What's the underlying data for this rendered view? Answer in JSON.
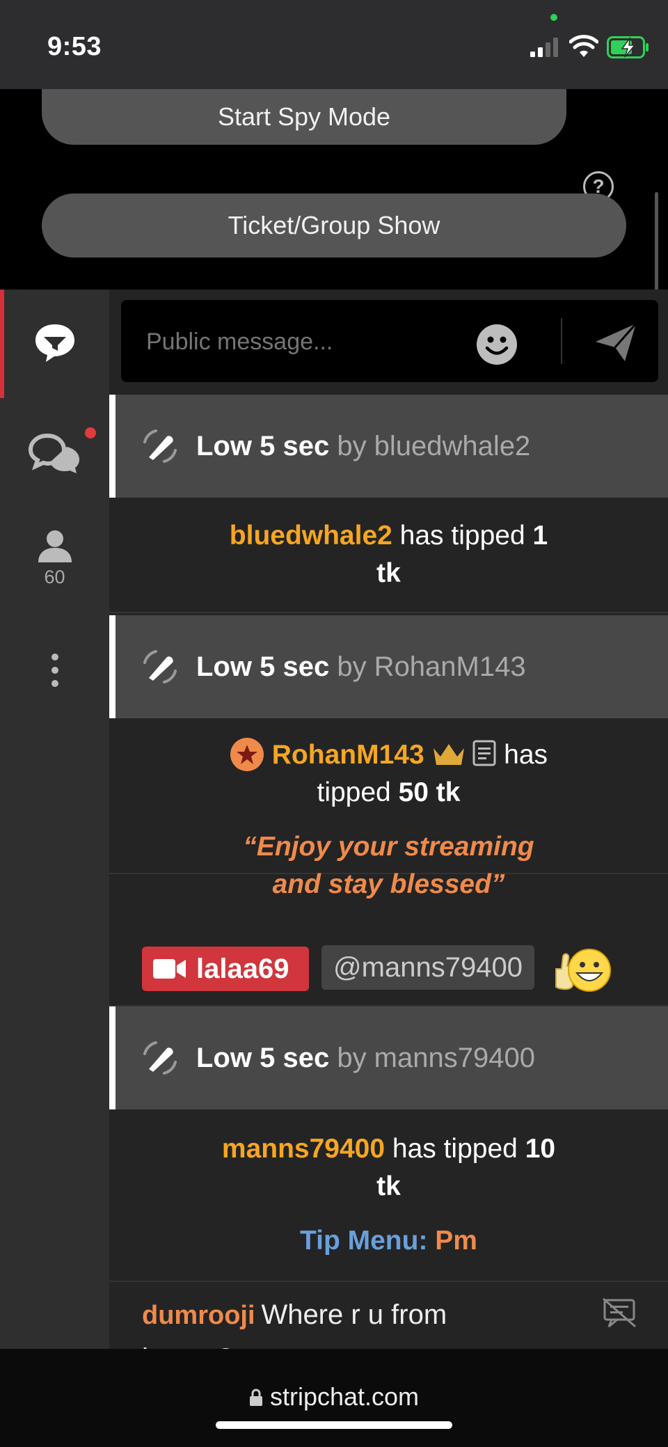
{
  "status": {
    "time": "9:53"
  },
  "top": {
    "spy_label": "Start Spy Mode",
    "ticket_label": "Ticket/Group Show",
    "help": "?"
  },
  "rail": {
    "users_count": "60"
  },
  "composer": {
    "placeholder": "Public message..."
  },
  "feed": {
    "goal1": {
      "strong": "Low 5 sec",
      "by": " by bluedwhale2"
    },
    "tip1": {
      "name": "bluedwhale2",
      "text": " has tipped ",
      "amount": "1",
      "unit": "tk"
    },
    "goal2": {
      "strong": "Low 5 sec",
      "by": " by RohanM143"
    },
    "tip2": {
      "name": "RohanM143",
      "text_a": " has",
      "text_b": "tipped ",
      "amount": "50 tk",
      "quote_line1": "“Enjoy your streaming",
      "quote_line2": "and stay blessed”"
    },
    "mention": {
      "user": "lalaa69",
      "mention": "@manns79400"
    },
    "goal3": {
      "strong": "Low 5 sec",
      "by": " by manns79400"
    },
    "tip3": {
      "name": "manns79400",
      "text": " has tipped ",
      "amount": "10",
      "unit": "tk",
      "menu_label": "Tip Menu: ",
      "menu_value": "Pm"
    },
    "msg": {
      "name": "dumrooji",
      "text": "Where r u from",
      "text2": "honey?"
    }
  },
  "browser": {
    "url": "stripchat.com"
  },
  "colors": {
    "accent_red": "#d6303a",
    "name_gold": "#f5a623",
    "orange": "#f08a4b",
    "link_blue": "#6a9fdc"
  }
}
